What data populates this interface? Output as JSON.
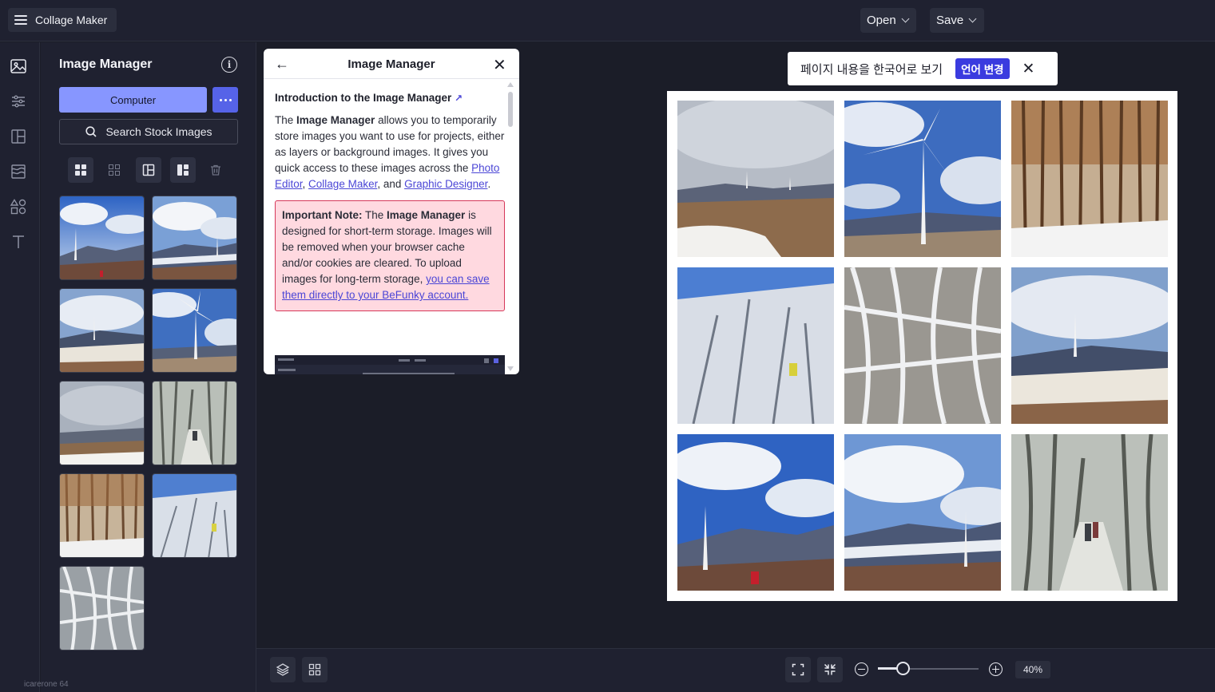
{
  "topbar": {
    "app_name": "Collage Maker",
    "open_label": "Open",
    "save_label": "Save"
  },
  "rail": {
    "icons": [
      "image-icon",
      "sliders-icon",
      "layout-icon",
      "texture-icon",
      "shapes-icon",
      "text-icon"
    ]
  },
  "panel": {
    "title": "Image Manager",
    "computer_label": "Computer",
    "search_label": "Search Stock Images",
    "view_icons": [
      "grid-large-icon",
      "grid-small-icon",
      "layout-split-icon",
      "layout-masonry-icon",
      "trash-icon"
    ],
    "thumbnails": [
      "wind turbine on snowy ridge with hiker",
      "wind turbines on distant snowy mountain",
      "wind turbine on snowy plateau",
      "wind turbine close-up with blue sky",
      "misty snowy plateau with turbines",
      "hikers on snowy forest trail",
      "larch forest in snow",
      "frosted trees with blue sky",
      "snow-covered branches close-up"
    ]
  },
  "help": {
    "title": "Image Manager",
    "heading": "Introduction to the Image Manager",
    "intro_p1": "The ",
    "intro_bold": "Image Manager",
    "intro_p2": " allows you to temporarily store images you want to use for projects, either as layers or background images. It gives you quick access to these images across the ",
    "link_photo_editor": "Photo Editor",
    "comma": ", ",
    "link_collage_maker": "Collage Maker",
    "and_text": ", and ",
    "link_graphic_designer": "Graphic Designer",
    "period": ".",
    "note_label": "Important Note:",
    "note_p1": " The ",
    "note_bold": "Image Manager",
    "note_p2": " is designed for short-term storage. Images will be removed when your browser cache and/or cookies are cleared. To upload images for long-term storage, ",
    "note_link": "you can save them directly to your BeFunky account."
  },
  "translate_bar": {
    "text": "페이지 내용을 한국어로 보기",
    "button": "언어 변경"
  },
  "canvas": {
    "cells": [
      "misty snowy plateau with turbines",
      "wind turbine close-up with blue sky",
      "larch forest in snow",
      "frosted trees with blue sky",
      "snow-covered branches close-up",
      "wind turbine on snowy plateau",
      "wind turbine on snowy ridge with hiker",
      "wind turbines on distant snowy mountain",
      "hikers on snowy forest trail"
    ]
  },
  "zoom": {
    "value_label": "40%",
    "level": 0.4
  },
  "stray_text": "icarerone      64"
}
